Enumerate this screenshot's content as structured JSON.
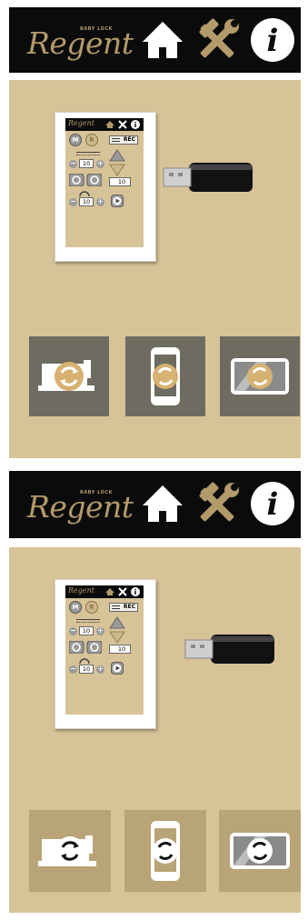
{
  "screens": [
    {
      "state": "arrow-connect",
      "header": {
        "brand": "Regent",
        "brand_tag": "BABY LOCK",
        "icons": [
          "home-icon",
          "tools-icon",
          "info-icon"
        ]
      },
      "device_preview": {
        "brand": "Regent",
        "buttons": [
          "M",
          "R"
        ],
        "rec_label": "REC",
        "stitch_value": "10",
        "speed_value": "10",
        "length_value": "10"
      },
      "tiles": [
        "machine-sync-icon",
        "phone-sync-icon",
        "tablet-sync-icon"
      ],
      "tile_style": "dark"
    },
    {
      "state": "usb-detached",
      "header": {
        "brand": "Regent",
        "brand_tag": "BABY LOCK",
        "icons": [
          "home-icon",
          "tools-icon",
          "info-icon"
        ]
      },
      "device_preview": {
        "brand": "Regent",
        "buttons": [
          "M",
          "R"
        ],
        "rec_label": "REC",
        "stitch_value": "10",
        "speed_value": "10",
        "length_value": "10"
      },
      "tiles": [
        "machine-sync-icon",
        "phone-sync-icon",
        "tablet-sync-icon"
      ],
      "tile_style": "tan"
    }
  ],
  "colors": {
    "topbar": "#0b0b0b",
    "gold": "#b39a6a",
    "panel": "#d7c398",
    "tile_dark": "#6e6c60",
    "tile_tan": "#b8a476",
    "arrow_red": "#c0171b"
  }
}
